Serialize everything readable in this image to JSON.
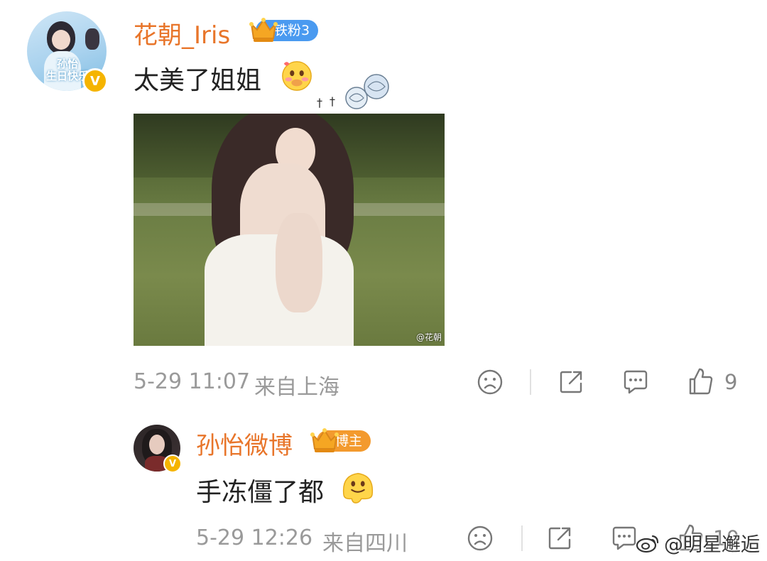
{
  "comment": {
    "username": "花朝_Iris",
    "fan_badge": "铁粉3",
    "text": "太美了姐姐",
    "avatar_caption": "孙怡\n生日快乐",
    "photo_watermark": "@花朝",
    "time": "5-29 11:07",
    "location": "来自上海",
    "like_count": "9"
  },
  "reply": {
    "username": "孙怡微博",
    "role_badge": "博主",
    "text": "手冻僵了都",
    "time": "5-29 12:26",
    "location": "来自四川",
    "like_count": "10"
  },
  "watermark": {
    "text": "@明星邂逅"
  },
  "icons": [
    "dislike-icon",
    "share-icon",
    "reply-icon",
    "like-icon",
    "verified-icon",
    "crown-icon",
    "weibo-logo-icon"
  ],
  "colors": {
    "username": "#e8752a",
    "fan_badge": "#4a9af0",
    "role_badge": "#f39a2e",
    "verified": "#f5b400",
    "meta": "#9a9a9a"
  }
}
